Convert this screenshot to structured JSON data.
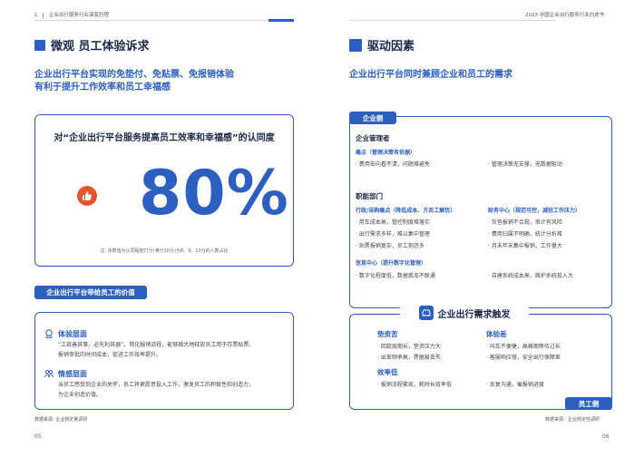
{
  "left": {
    "header": {
      "page_index": "1",
      "section": "企业出行服务行业演变历程"
    },
    "title": "微观 员工体验诉求",
    "subhead": [
      "企业出行平台实现的免垫付、免贴票、免报销体验",
      "有利于提升工作效率和员工幸福感"
    ],
    "stat": {
      "question": "对“企业出行平台服务提高员工效率和幸福感”的认同度",
      "value": "80%",
      "note": "注: 该数值为认同程度打分(满分10分)为8、9、10分的人数占比"
    },
    "value_tag": "企业出行平台带给员工的价值",
    "values": [
      {
        "title": "体验层面",
        "lines": [
          "“工欲善其事，必先利其器”。简化报销流程，能够极大地释放员工用于存票贴票、",
          "报销审批的时间成本，促进工作效率提升。"
        ]
      },
      {
        "title": "情感层面",
        "lines": [
          "当员工感受到企业的关怀，员工将更愿意投入工作，激发员工的积极性和创造力，",
          "为企业创造价值。"
        ]
      }
    ],
    "source": "数据来源: 企业侧定量调研",
    "page_number": "05"
  },
  "right": {
    "header": "2023 中国企业出行服务行业白皮书",
    "title": "驱动因素",
    "subhead": "企业出行平台同时兼顾企业和员工的需求",
    "enterprise_tag": "企业侧",
    "managers": {
      "title": "企业管理者",
      "pain_title": "痛点（管理决策有依据）",
      "items_left": [
        "费用去向看不清，问题难避免"
      ],
      "items_right": [
        "管理决策无支撑，无数据驱动"
      ]
    },
    "functions": {
      "title": "职能部门",
      "procure_title": "行政/采购痛点（降低成本、方员工解忧）",
      "procure_items": [
        "用车成本高，管控制度难落实",
        "出行需求多样，难以集中管理",
        "贴票报销复杂，员工抱怨多"
      ],
      "finance_title": "财务中心（规范可控，减轻工作压力）",
      "finance_items": [
        "灰色报销不合规，审计有风险",
        "费用归属不明确，统计分析难",
        "月末年末集中报销，工作量大"
      ],
      "it_title": "信息中心（提升数字化管理）",
      "it_items_left": [
        "数字化程度低，数据孤岛不联通"
      ],
      "it_items_right": [
        "自建系统成本高，维护系统投入大"
      ]
    },
    "banner": "企业出行需求触发",
    "employee_needs": [
      {
        "title": "垫资苦",
        "items": [
          "回款周期长，垫资压力大",
          "出差频率高，票据易丢失"
        ]
      },
      {
        "title": "体验差",
        "items": [
          "叫车不便捷，高峰期等待过长",
          "客服响应慢，安全出行保障差"
        ]
      },
      {
        "title": "效率低",
        "items": [
          "报销流程繁琐，耗时长效率低"
        ]
      }
    ],
    "employee_extra": [
      "反复沟通，催报销进度"
    ],
    "employee_tag": "员工侧",
    "source": "数据来源：企业侧定性调研",
    "page_number": "06"
  },
  "colors": {
    "accent": "#2c5fbf",
    "thumb": "#e8542c",
    "heading": "#1b2a4a"
  }
}
